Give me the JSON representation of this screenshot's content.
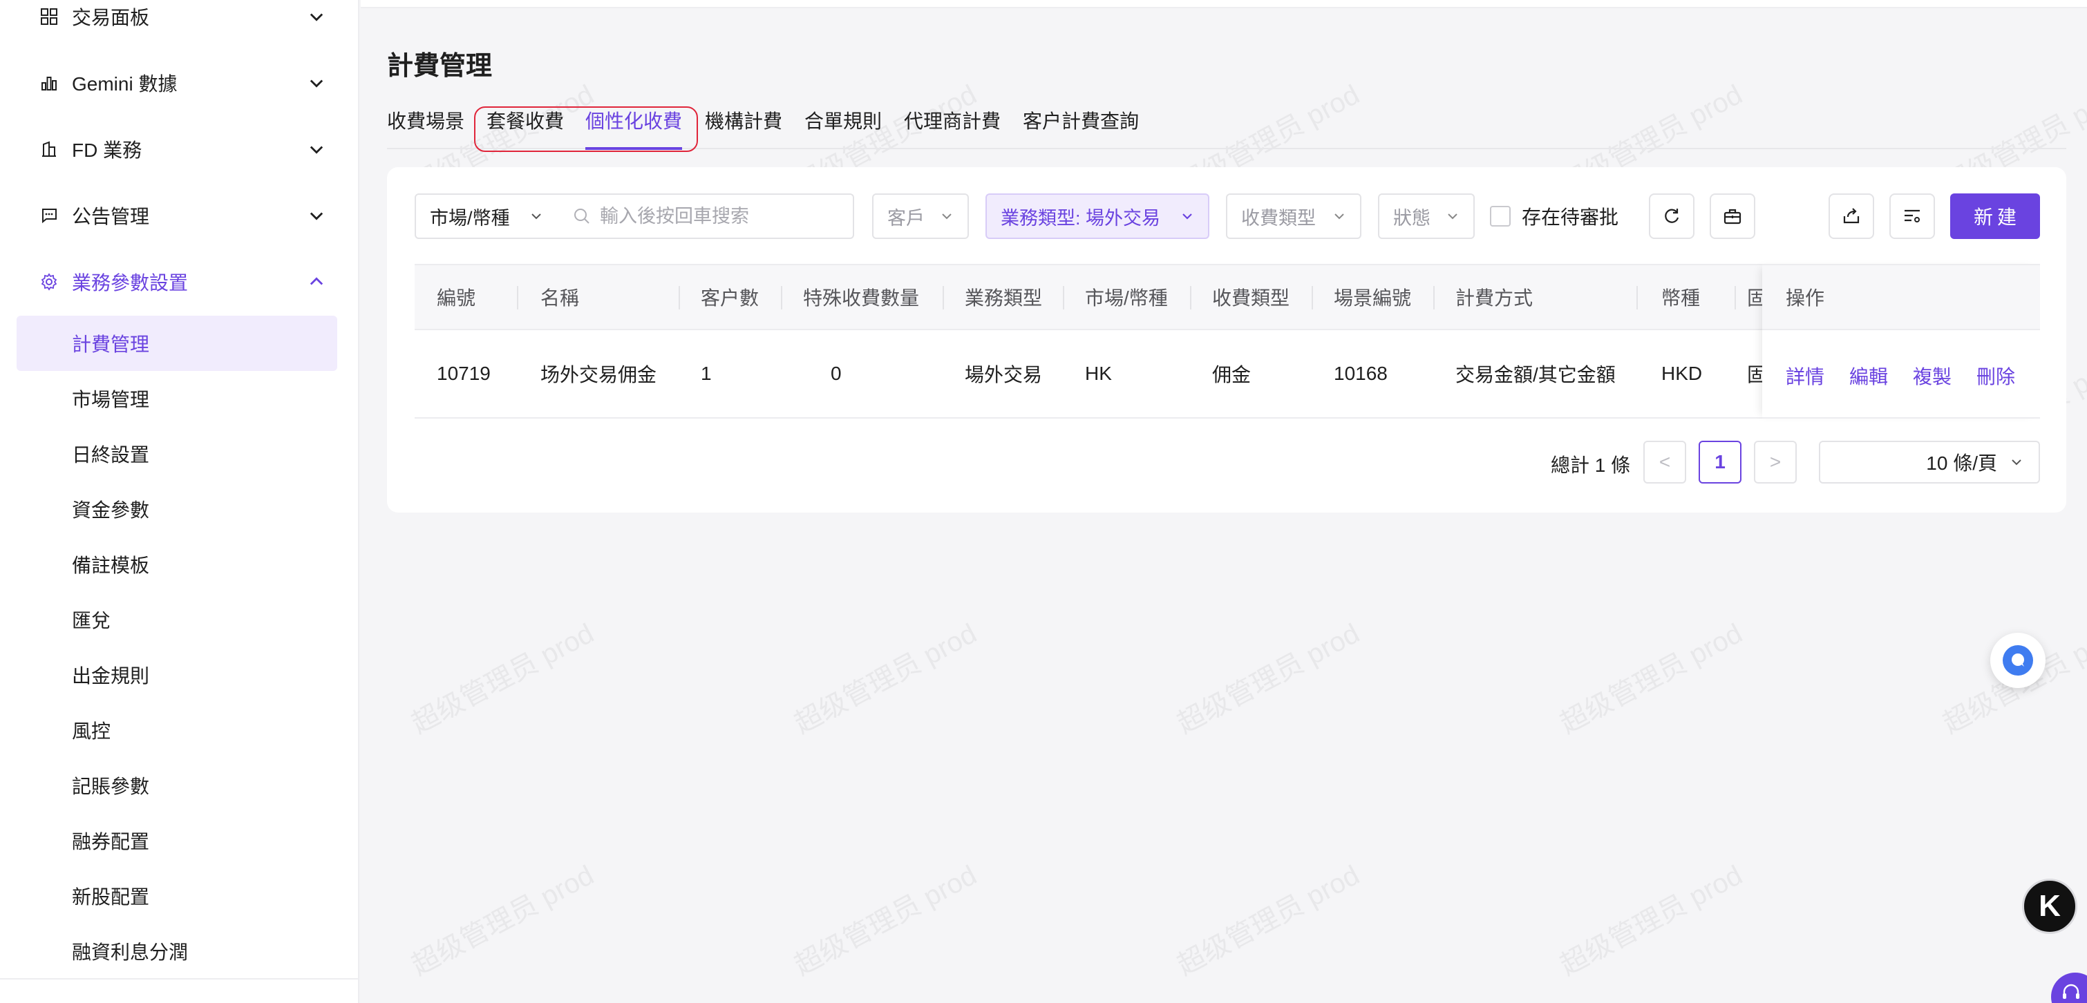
{
  "sidebar": {
    "menu": [
      {
        "label": "交易面板",
        "icon": "dashboard-icon"
      },
      {
        "label": "Gemini 數據",
        "icon": "bar-chart-icon"
      },
      {
        "label": "FD 業務",
        "icon": "bank-icon"
      },
      {
        "label": "公告管理",
        "icon": "message-icon"
      },
      {
        "label": "業務參數設置",
        "icon": "settings-icon"
      }
    ],
    "submenu": [
      {
        "label": "計費管理"
      },
      {
        "label": "市場管理"
      },
      {
        "label": "日終設置"
      },
      {
        "label": "資金參數"
      },
      {
        "label": "備註模板"
      },
      {
        "label": "匯兌"
      },
      {
        "label": "出金規則"
      },
      {
        "label": "風控"
      },
      {
        "label": "記賬參數"
      },
      {
        "label": "融券配置"
      },
      {
        "label": "新股配置"
      },
      {
        "label": "融資利息分潤"
      }
    ]
  },
  "page": {
    "title": "計費管理",
    "tabs": [
      {
        "label": "收費場景"
      },
      {
        "label": "套餐收費"
      },
      {
        "label": "個性化收費"
      },
      {
        "label": "機構計費"
      },
      {
        "label": "合單規則"
      },
      {
        "label": "代理商計費"
      },
      {
        "label": "客户計費查詢"
      }
    ],
    "active_tab": "個性化收費"
  },
  "filters": {
    "market_select": "市場/幣種",
    "search_placeholder": "輸入後按回車搜索",
    "customer_select": "客戶",
    "business_type_select": "業務類型: 場外交易",
    "fee_type_select": "收費類型",
    "status_select": "狀態",
    "pending_checkbox_label": "存在待審批",
    "pending_checked": false,
    "new_button": "新建"
  },
  "table": {
    "columns": [
      "編號",
      "名稱",
      "客户數",
      "特殊收費數量",
      "業務類型",
      "市場/幣種",
      "收費類型",
      "場景編號",
      "計費方式",
      "幣種",
      "固",
      "操作"
    ],
    "rows": [
      {
        "id": "10719",
        "name": "场外交易佣金",
        "customer_count": "1",
        "special_fee_count": "0",
        "business_type": "場外交易",
        "market": "HK",
        "fee_type": "佣金",
        "scene_id": "10168",
        "billing_method": "交易金額/其它金額",
        "currency": "HKD",
        "fixed": "固",
        "actions": [
          "詳情",
          "編輯",
          "複製",
          "刪除"
        ]
      }
    ]
  },
  "pagination": {
    "total": "總計 1 條",
    "current_page": "1",
    "prev": "<",
    "next": ">",
    "page_size": "10 條/頁"
  },
  "watermark": "超级管理员 prod",
  "floating": {
    "k_label": "K"
  },
  "colors": {
    "accent": "#6a43e0",
    "highlight_outline": "#e0253a"
  }
}
